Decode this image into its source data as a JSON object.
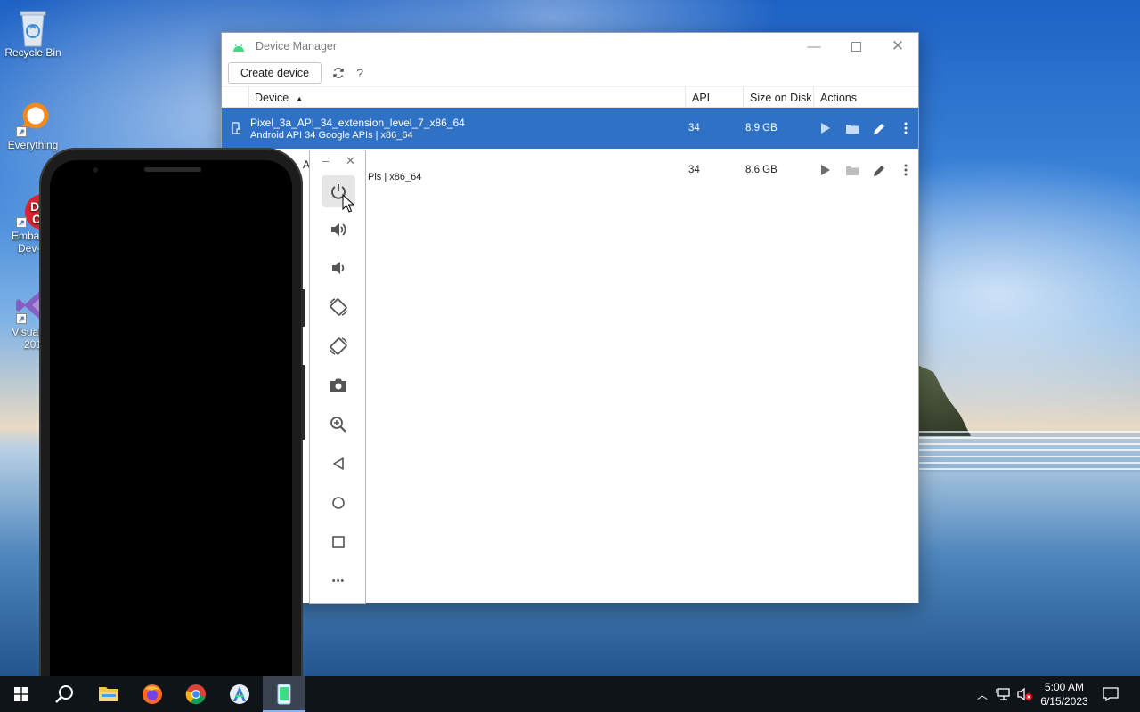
{
  "desktop": {
    "icons": [
      {
        "label": "Recycle Bin"
      },
      {
        "label": "Everything"
      },
      {
        "label": "Embarca\nDev-C"
      },
      {
        "label": "Visual St\n201"
      }
    ]
  },
  "device_manager": {
    "title": "Device Manager",
    "toolbar": {
      "create_label": "Create device",
      "help_label": "?"
    },
    "columns": {
      "device": "Device",
      "api": "API",
      "size": "Size on Disk",
      "actions": "Actions"
    },
    "rows": [
      {
        "name": "Pixel_3a_API_34_extension_level_7_x86_64",
        "sub": "Android API 34 Google APIs | x86_64",
        "api": "34",
        "size": "8.9 GB"
      },
      {
        "name": "A",
        "sub": "Pls | x86_64",
        "api": "34",
        "size": "8.6 GB"
      }
    ]
  },
  "emulator_toolbar": {
    "more_label": "•••"
  },
  "taskbar": {
    "time": "5:00 AM",
    "date": "6/15/2023"
  },
  "colors": {
    "selected_row": "#2f72c5",
    "taskbar": "#0f1419",
    "android_green": "#3ddc84"
  }
}
